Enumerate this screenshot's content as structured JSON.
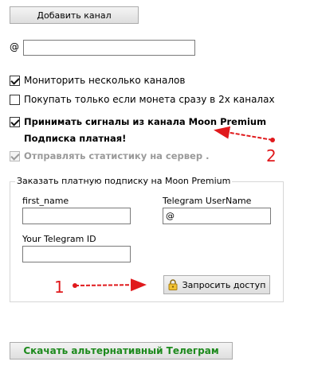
{
  "add_channel_label": "Добавить канал",
  "at_symbol": "@",
  "channel_input_value": "",
  "checkboxes": {
    "monitor_multiple": {
      "label": "Мониторить несколько каналов",
      "checked": true
    },
    "buy_only_2x": {
      "label": "Покупать только если монета сразу в 2х каналах",
      "checked": false
    },
    "moon_premium": {
      "label": "Принимать сигналы из канала Moon Premium",
      "checked": true
    },
    "send_stats": {
      "label": "Отправлять статистику на сервер .",
      "checked": true,
      "disabled": true
    }
  },
  "paid_subscription_note": "Подписка платная!",
  "subscription_group": {
    "title": "Заказать платную подписку на Moon Premium",
    "first_name_label": "first_name",
    "first_name_value": "",
    "telegram_username_label": "Telegram UserName",
    "telegram_username_value": "@",
    "telegram_id_label": "Your Telegram ID",
    "telegram_id_value": "",
    "request_access_label": "Запросить доступ"
  },
  "download_telegram_label": "Скачать альтернативный Телеграм",
  "annotations": {
    "num1": "1",
    "num2": "2",
    "color": "#e0191c"
  },
  "icons": {
    "request_access": "lock-icon"
  }
}
